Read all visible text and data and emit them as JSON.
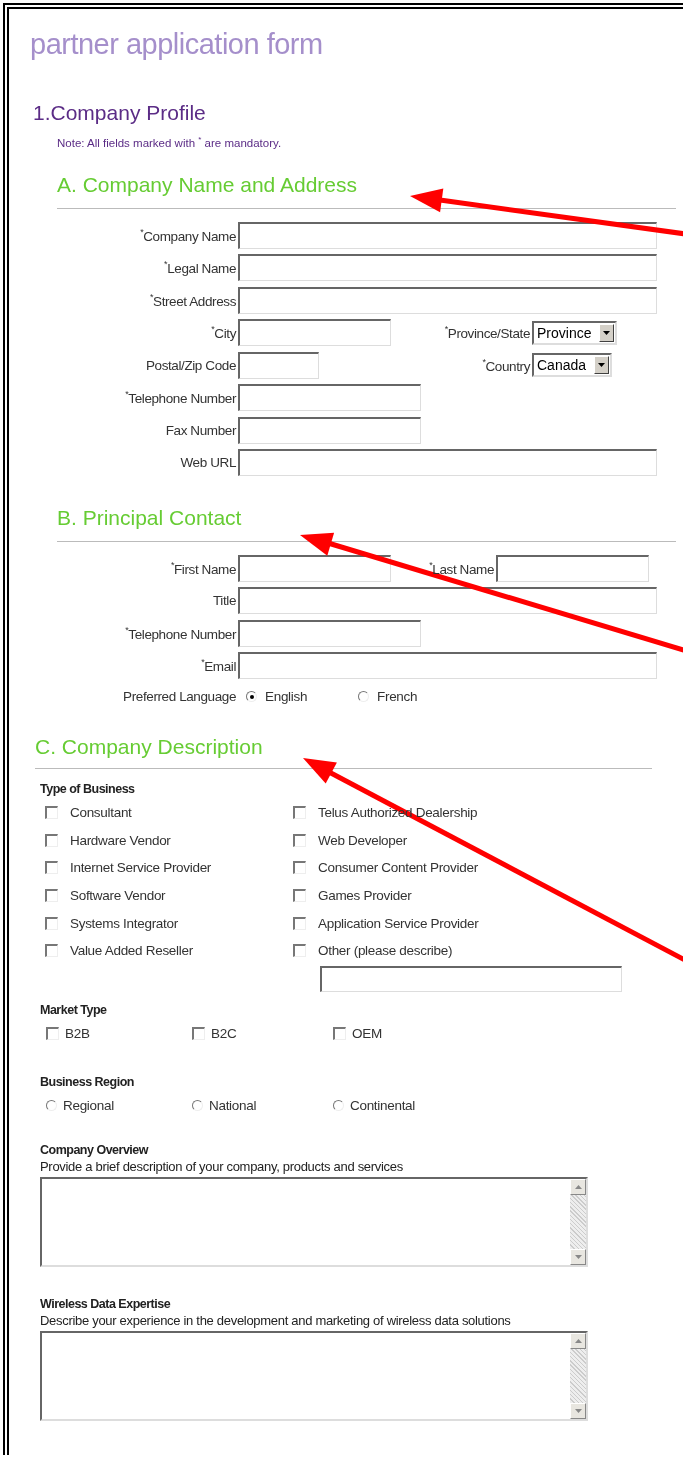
{
  "page_title": "partner application form",
  "section_title": "1.Company Profile",
  "note": "Note: All fields marked with $^{*}$ are mandatory.",
  "subsections": [
    {
      "heading": "A. Company Name and Address",
      "kind": "fields",
      "rows": [
        {
          "fields": [
            {
              "label": "$^{*}$Company Name",
              "kind": "wide"
            }
          ]
        },
        {
          "fields": [
            {
              "label": "$^{*}$Legal Name",
              "kind": "wide"
            }
          ]
        },
        {
          "fields": [
            {
              "label": "$^{*}$Street Address",
              "kind": "wide"
            }
          ]
        },
        {
          "fields": [
            {
              "label": "$^{*}$City",
              "kind": "narrow"
            },
            {
              "label": "$^{*}$Province/State",
              "kind": "select",
              "value": "Province"
            }
          ]
        },
        {
          "fields": [
            {
              "label": "Postal/Zip Code",
              "kind": "tiny"
            },
            {
              "label": "$^{*}$Country",
              "kind": "select",
              "value": "Canada"
            }
          ]
        },
        {
          "fields": [
            {
              "label": "$^{*}$Telephone Number",
              "kind": "medium"
            }
          ]
        },
        {
          "fields": [
            {
              "label": "Fax Number",
              "kind": "medium"
            }
          ]
        },
        {
          "fields": [
            {
              "label": "Web URL",
              "kind": "wide"
            }
          ]
        }
      ]
    },
    {
      "heading": "B. Principal Contact",
      "kind": "fields",
      "rows": [
        {
          "fields": [
            {
              "label": "$^{*}$First Name",
              "kind": "narrow"
            },
            {
              "label": "$^{*}$Last Name",
              "kind": "narrow"
            }
          ]
        },
        {
          "fields": [
            {
              "label": "Title",
              "kind": "wide"
            }
          ]
        },
        {
          "fields": [
            {
              "label": "$^{*}$Telephone Number",
              "kind": "medium"
            }
          ]
        },
        {
          "fields": [
            {
              "label": "$^{*}$Email",
              "kind": "wide"
            }
          ]
        }
      ],
      "language": {
        "label": "Preferred Language",
        "options": [
          {
            "label": "English",
            "selected": true
          },
          {
            "label": "French",
            "selected": false
          }
        ]
      }
    },
    {
      "heading": "C. Company Description",
      "kind": "groups",
      "groups": [
        {
          "label": "Type of Business",
          "kind": "checkbox-columns",
          "columns": [
            [
              {
                "label": "Consultant",
                "checked": false,
                "kind": "plain"
              },
              {
                "label": "Hardware Vendor",
                "checked": false,
                "kind": "plain"
              },
              {
                "label": "Internet Service Provider",
                "checked": false,
                "kind": "plain"
              },
              {
                "label": "Software Vendor",
                "checked": false,
                "kind": "plain"
              },
              {
                "label": "Systems Integrator",
                "checked": false,
                "kind": "plain"
              },
              {
                "label": "Value Added Reseller",
                "checked": false,
                "kind": "plain"
              }
            ],
            [
              {
                "label": "Telus Authorized Dealership",
                "checked": false,
                "kind": "plain"
              },
              {
                "label": "Web Developer",
                "checked": false,
                "kind": "plain"
              },
              {
                "label": "Consumer Content Provider",
                "checked": false,
                "kind": "plain"
              },
              {
                "label": "Games Provider",
                "checked": false,
                "kind": "plain"
              },
              {
                "label": "Application Service Provider",
                "checked": false,
                "kind": "plain"
              },
              {
                "label": "Other (please describe)",
                "checked": false,
                "kind": "with-field"
              }
            ]
          ]
        },
        {
          "label": "Market Type",
          "kind": "checkbox-row",
          "items": [
            {
              "label": "B2B",
              "checked": false
            },
            {
              "label": "B2C",
              "checked": false
            },
            {
              "label": "OEM",
              "checked": false
            }
          ]
        },
        {
          "label": "Business Region",
          "kind": "radio-row",
          "items": [
            {
              "label": "Regional",
              "selected": false
            },
            {
              "label": "National",
              "selected": false
            },
            {
              "label": "Continental",
              "selected": false
            }
          ]
        },
        {
          "label": "Company Overview",
          "kind": "textarea",
          "hint": "Provide a brief description of your company, products and services"
        },
        {
          "label": "Wireless Data Expertise",
          "kind": "textarea",
          "hint": "Describe your experience in the development and marketing of wireless data solutions"
        }
      ]
    }
  ]
}
